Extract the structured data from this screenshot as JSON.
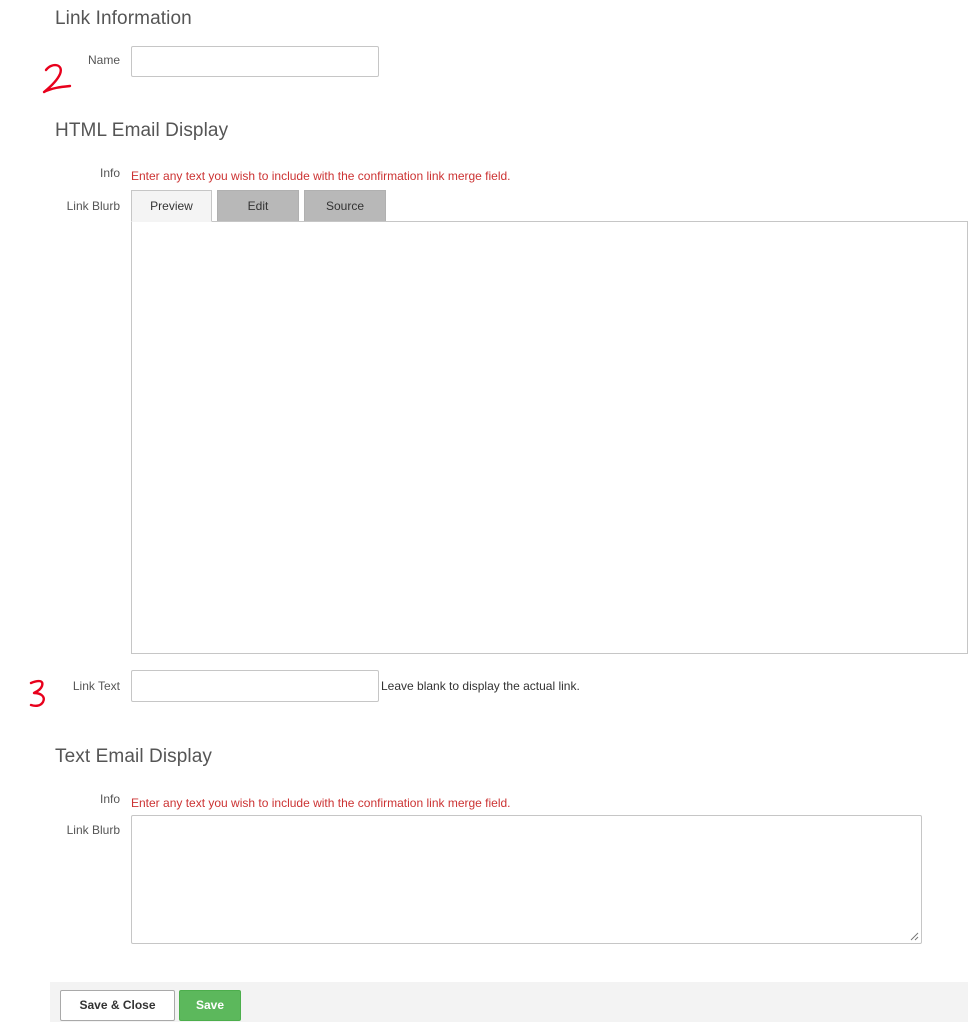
{
  "link_information": {
    "title": "Link Information",
    "name_label": "Name",
    "name_value": ""
  },
  "html_email_display": {
    "title": "HTML Email Display",
    "info_label": "Info",
    "info_text": "Enter any text you wish to include with the confirmation link merge field.",
    "blurb_label": "Link Blurb",
    "tabs": [
      {
        "label": "Preview",
        "active": true
      },
      {
        "label": "Edit",
        "active": false
      },
      {
        "label": "Source",
        "active": false
      }
    ],
    "link_text_label": "Link Text",
    "link_text_value": "",
    "link_text_hint": "Leave blank to display the actual link."
  },
  "text_email_display": {
    "title": "Text Email Display",
    "info_label": "Info",
    "info_text": "Enter any text you wish to include with the confirmation link merge field.",
    "blurb_label": "Link Blurb",
    "blurb_value": ""
  },
  "footer": {
    "save_close_label": "Save & Close",
    "save_label": "Save"
  },
  "annotations": {
    "mark_2": "2",
    "mark_3": "3",
    "color": "#e8001c"
  },
  "colors": {
    "info_red": "#cc3333",
    "save_green": "#5cb85c",
    "inactive_tab": "#b8b8b8"
  }
}
